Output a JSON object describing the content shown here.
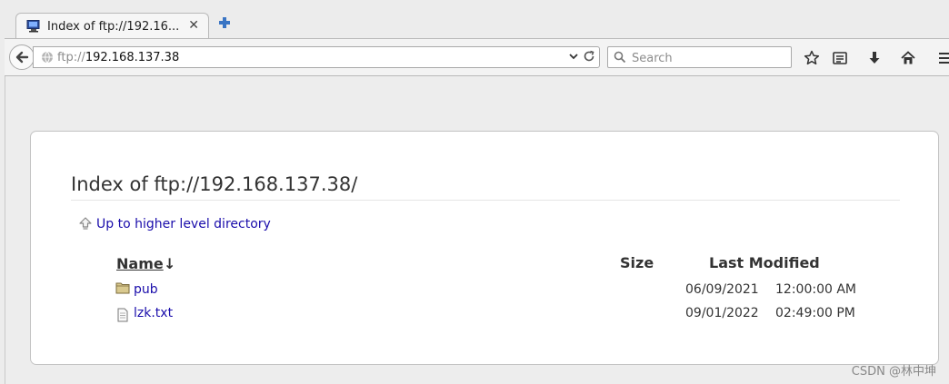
{
  "browser": {
    "tab": {
      "title": "Index of ftp://192.16...",
      "close": "✕"
    },
    "url": {
      "protocol": "ftp://",
      "host": "192.168.137.38"
    },
    "search": {
      "placeholder": "Search"
    }
  },
  "page": {
    "title": "Index of ftp://192.168.137.38/",
    "up_link": "Up to higher level directory",
    "columns": {
      "name": "Name",
      "sort_indicator": "↓",
      "size": "Size",
      "modified": "Last Modified"
    },
    "rows": [
      {
        "type": "folder",
        "name": "pub",
        "size": "",
        "date": "06/09/2021",
        "time": "12:00:00 AM"
      },
      {
        "type": "file",
        "name": "lzk.txt",
        "size": "",
        "date": "09/01/2022",
        "time": "02:49:00 PM"
      }
    ]
  },
  "watermark": "CSDN @林中坤",
  "colors": {
    "link": "#1a0dab",
    "chrome_bg": "#ededed",
    "card_border": "#c3c3c3"
  }
}
